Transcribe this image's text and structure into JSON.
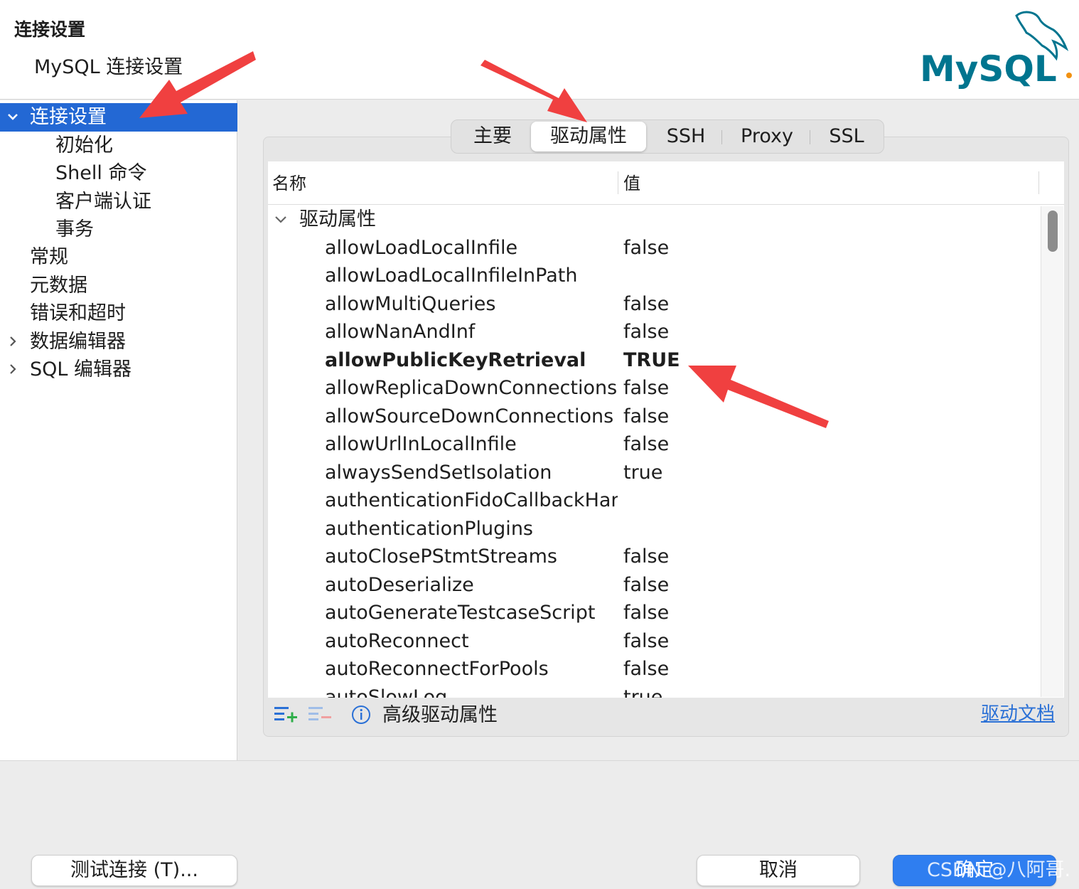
{
  "header": {
    "title": "连接设置",
    "subtitle": "MySQL 连接设置",
    "logo_text": "MySQL"
  },
  "sidebar": {
    "items": [
      {
        "label": "连接设置",
        "selected": true,
        "expander": "expanded"
      },
      {
        "label": "初始化"
      },
      {
        "label": "Shell 命令"
      },
      {
        "label": "客户端认证"
      },
      {
        "label": "事务"
      },
      {
        "label": "常规"
      },
      {
        "label": "元数据"
      },
      {
        "label": "错误和超时"
      },
      {
        "label": "数据编辑器",
        "expander": "collapsed"
      },
      {
        "label": "SQL 编辑器",
        "expander": "collapsed"
      }
    ]
  },
  "tabs": [
    {
      "label": "主要"
    },
    {
      "label": "驱动属性",
      "active": true
    },
    {
      "label": "SSH"
    },
    {
      "label": "Proxy"
    },
    {
      "label": "SSL"
    }
  ],
  "grid": {
    "columns": {
      "name": "名称",
      "value": "值"
    },
    "group_label": "驱动属性",
    "rows": [
      {
        "name": "allowLoadLocalInfile",
        "value": "false"
      },
      {
        "name": "allowLoadLocalInfileInPath",
        "value": ""
      },
      {
        "name": "allowMultiQueries",
        "value": "false"
      },
      {
        "name": "allowNanAndInf",
        "value": "false"
      },
      {
        "name": "allowPublicKeyRetrieval",
        "value": "TRUE",
        "bold": true
      },
      {
        "name": "allowReplicaDownConnections",
        "value": "false"
      },
      {
        "name": "allowSourceDownConnections",
        "value": "false"
      },
      {
        "name": "allowUrlInLocalInfile",
        "value": "false"
      },
      {
        "name": "alwaysSendSetIsolation",
        "value": "true"
      },
      {
        "name": "authenticationFidoCallbackHan",
        "value": ""
      },
      {
        "name": "authenticationPlugins",
        "value": ""
      },
      {
        "name": "autoClosePStmtStreams",
        "value": "false"
      },
      {
        "name": "autoDeserialize",
        "value": "false"
      },
      {
        "name": "autoGenerateTestcaseScript",
        "value": "false"
      },
      {
        "name": "autoReconnect",
        "value": "false"
      },
      {
        "name": "autoReconnectForPools",
        "value": "false"
      },
      {
        "name": "autoSlowLog",
        "value": "true"
      }
    ]
  },
  "bottom_bar": {
    "advanced_label": "高级驱动属性",
    "doc_link": "驱动文档",
    "icons": [
      "add-property-icon",
      "remove-property-icon",
      "info-icon"
    ]
  },
  "buttons": {
    "test": "测试连接 (T)...",
    "cancel": "取消",
    "ok": "确定"
  },
  "watermark": "CSDN @八阿哥.",
  "colors": {
    "accent": "#2368d4",
    "primary_button": "#2f7ef0",
    "link": "#2a70d6",
    "annotation_arrow": "#f04040",
    "logo_blue": "#00758f",
    "logo_orange": "#f29111"
  }
}
